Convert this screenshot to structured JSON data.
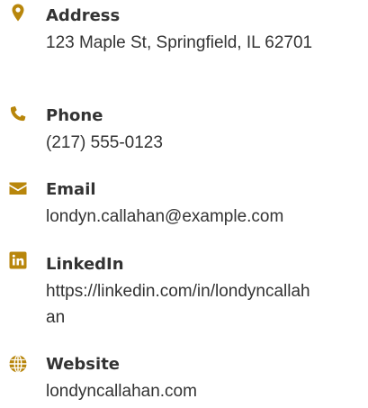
{
  "accent_color": "#b8860b",
  "text_color": "#333333",
  "contacts": [
    {
      "icon": "map-marker-icon",
      "label": "Address",
      "value": "123 Maple St, Springfield, IL 62701"
    },
    {
      "icon": "phone-icon",
      "label": "Phone",
      "value": "(217) 555-0123"
    },
    {
      "icon": "envelope-icon",
      "label": "Email",
      "value": "londyn.callahan@example.com"
    },
    {
      "icon": "linkedin-icon",
      "label": "LinkedIn",
      "value": "https://linkedin.com/in/londyncallahan"
    },
    {
      "icon": "globe-icon",
      "label": "Website",
      "value": "londyncallahan.com"
    }
  ]
}
